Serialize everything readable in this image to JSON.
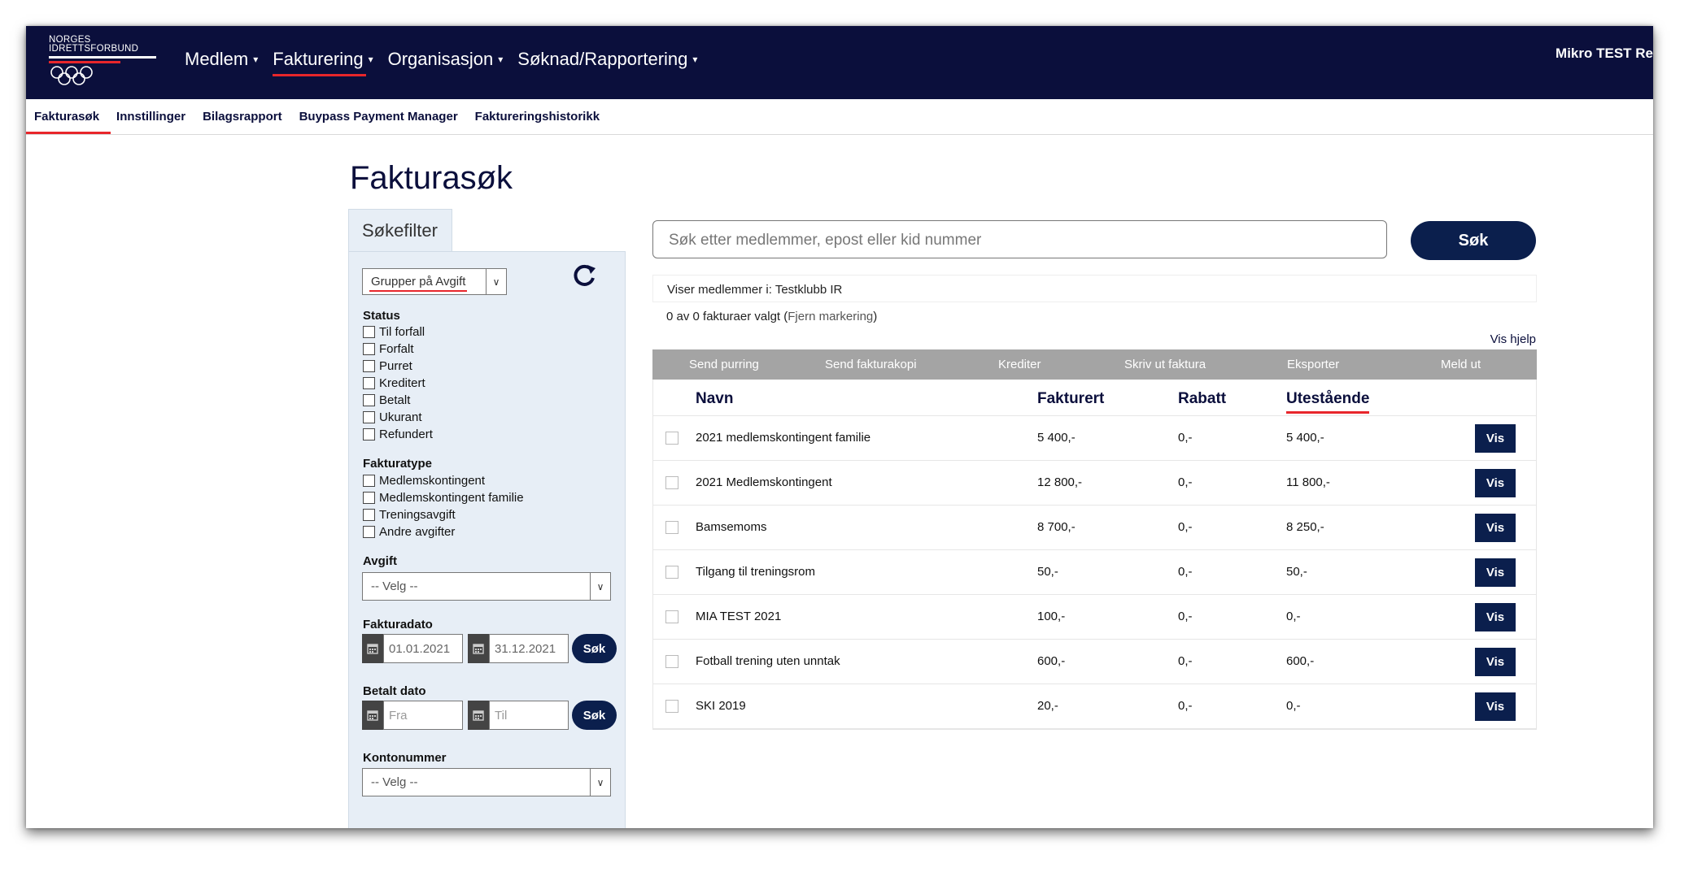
{
  "brand": {
    "logo_line1": "NORGES",
    "logo_line2": "IDRETTSFORBUND"
  },
  "topnav": {
    "items": [
      {
        "label": "Medlem"
      },
      {
        "label": "Fakturering"
      },
      {
        "label": "Organisasjon"
      },
      {
        "label": "Søknad/Rapportering"
      }
    ],
    "user": "Mikro TEST Re"
  },
  "subnav": {
    "items": [
      {
        "label": "Fakturasøk"
      },
      {
        "label": "Innstillinger"
      },
      {
        "label": "Bilagsrapport"
      },
      {
        "label": "Buypass Payment Manager"
      },
      {
        "label": "Faktureringshistorikk"
      }
    ]
  },
  "page": {
    "title": "Fakturasøk"
  },
  "filter": {
    "tab_label": "Søkefilter",
    "group_select": "Grupper på Avgift",
    "status_heading": "Status",
    "status_options": [
      "Til forfall",
      "Forfalt",
      "Purret",
      "Kreditert",
      "Betalt",
      "Ukurant",
      "Refundert"
    ],
    "fakturatype_heading": "Fakturatype",
    "fakturatype_options": [
      "Medlemskontingent",
      "Medlemskontingent familie",
      "Treningsavgift",
      "Andre avgifter"
    ],
    "avgift_heading": "Avgift",
    "avgift_select": "-- Velg --",
    "fakturadato_heading": "Fakturadato",
    "fakturadato_from": "01.01.2021",
    "fakturadato_to": "31.12.2021",
    "betalt_heading": "Betalt dato",
    "betalt_from_placeholder": "Fra",
    "betalt_to_placeholder": "Til",
    "search_button": "Søk",
    "kontonummer_heading": "Kontonummer",
    "kontonummer_select": "-- Velg --"
  },
  "search": {
    "placeholder": "Søk etter medlemmer, epost eller kid nummer",
    "button": "Søk",
    "showing": "Viser medlemmer i: Testklubb IR",
    "selected_count": "0 av 0 fakturaer valgt (",
    "clear_link": "Fjern markering",
    "selected_close": ")",
    "help": "Vis hjelp"
  },
  "actions": [
    "Send purring",
    "Send fakturakopi",
    "Krediter",
    "Skriv ut faktura",
    "Eksporter",
    "Meld ut"
  ],
  "table": {
    "headers": {
      "name": "Navn",
      "invoiced": "Fakturert",
      "discount": "Rabatt",
      "outstanding": "Utestående"
    },
    "rows": [
      {
        "name": "2021 medlemskontingent familie",
        "invoiced": "5 400,-",
        "discount": "0,-",
        "outstanding": "5 400,-",
        "button": "Vis"
      },
      {
        "name": "2021 Medlemskontingent",
        "invoiced": "12 800,-",
        "discount": "0,-",
        "outstanding": "11 800,-",
        "button": "Vis"
      },
      {
        "name": "Bamsemoms",
        "invoiced": "8 700,-",
        "discount": "0,-",
        "outstanding": "8 250,-",
        "button": "Vis"
      },
      {
        "name": "Tilgang til treningsrom",
        "invoiced": "50,-",
        "discount": "0,-",
        "outstanding": "50,-",
        "button": "Vis"
      },
      {
        "name": "MIA TEST 2021",
        "invoiced": "100,-",
        "discount": "0,-",
        "outstanding": "0,-",
        "button": "Vis"
      },
      {
        "name": "Fotball trening uten unntak",
        "invoiced": "600,-",
        "discount": "0,-",
        "outstanding": "600,-",
        "button": "Vis"
      },
      {
        "name": "SKI 2019",
        "invoiced": "20,-",
        "discount": "0,-",
        "outstanding": "0,-",
        "button": "Vis"
      }
    ]
  },
  "colors": {
    "navy": "#0b0f3c",
    "button_navy": "#0b1f4d",
    "accent_red": "#e8262b",
    "panel_bg": "#e7eef6",
    "action_bar": "#a4a4a4"
  },
  "icons": {
    "refresh": "refresh-icon",
    "calendar": "calendar-icon",
    "dropdown": "chevron-down-icon",
    "logo": "olympic-rings-icon"
  }
}
